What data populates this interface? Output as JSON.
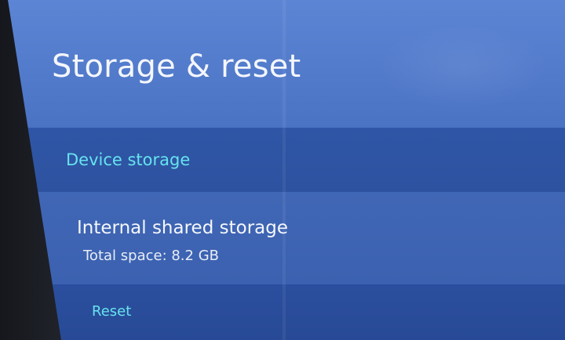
{
  "page": {
    "title": "Storage & reset"
  },
  "sections": {
    "device_storage": {
      "header": "Device storage",
      "item": {
        "title": "Internal shared storage",
        "summary": "Total space: 8.2 GB"
      }
    },
    "reset": {
      "label": "Reset"
    }
  },
  "colors": {
    "accent": "#66e3ee",
    "header_background": "#5c85d4",
    "section_background": "#2f56a6",
    "item_background": "#4067b5"
  }
}
